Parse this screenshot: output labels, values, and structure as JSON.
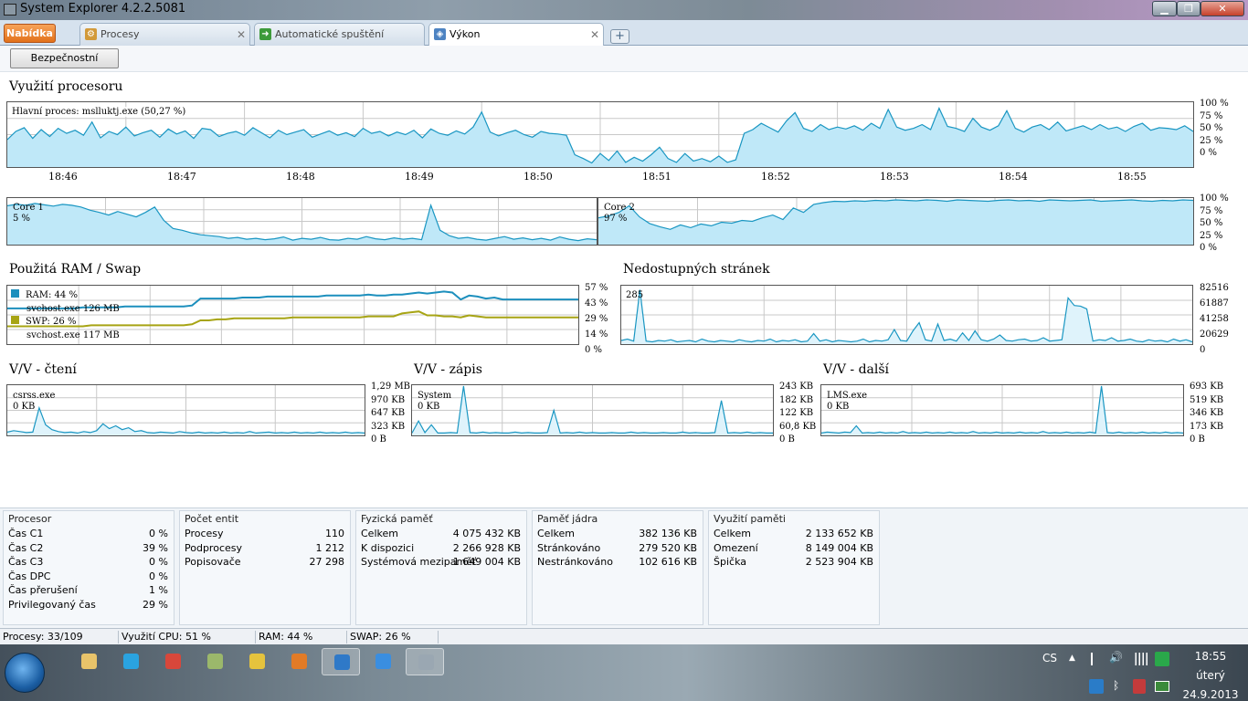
{
  "window": {
    "title": "System Explorer 4.2.2.5081",
    "minimize": "▁",
    "maximize": "❐",
    "close": "✕"
  },
  "menu_button": "Nabídka",
  "tabs": [
    {
      "label": "Procesy",
      "icon": "gear-icon"
    },
    {
      "label": "Automatické spuštění",
      "icon": "startup-arrow-icon"
    },
    {
      "label": "Výkon",
      "icon": "performance-icon"
    }
  ],
  "add_tab": "+",
  "tab_close": "✕",
  "toolbar": {
    "security_button": "Bezpečnostní kontrola"
  },
  "cpu": {
    "title": "Využití procesoru",
    "main_process": "Hlavní proces: mslluktj.exe (50,27 %)",
    "y_axis": [
      "100 %",
      "75 %",
      "50 %",
      "25 %",
      "0 %"
    ],
    "time_ticks": [
      "18:46",
      "18:47",
      "18:48",
      "18:49",
      "18:50",
      "18:51",
      "18:52",
      "18:53",
      "18:54",
      "18:55"
    ],
    "series_percent": [
      42,
      55,
      61,
      44,
      58,
      47,
      60,
      52,
      57,
      49,
      70,
      45,
      55,
      50,
      62,
      48,
      53,
      57,
      46,
      59,
      51,
      56,
      44,
      60,
      58,
      47,
      52,
      55,
      49,
      61,
      53,
      45,
      57,
      50,
      54,
      58,
      46,
      51,
      56,
      49,
      53,
      47,
      60,
      52,
      55,
      48,
      54,
      50,
      57,
      45,
      59,
      52,
      49,
      56,
      51,
      62,
      86,
      54,
      48,
      53,
      57,
      50,
      46,
      55,
      52,
      51,
      49,
      18,
      12,
      5,
      20,
      9,
      24,
      6,
      14,
      8,
      18,
      30,
      12,
      6,
      20,
      8,
      12,
      7,
      16,
      6,
      10,
      52,
      58,
      68,
      61,
      54,
      72,
      85,
      60,
      55,
      66,
      58,
      62,
      59,
      64,
      57,
      68,
      60,
      90,
      62,
      57,
      60,
      66,
      58,
      92,
      63,
      60,
      55,
      76,
      62,
      57,
      64,
      88,
      60,
      54,
      62,
      66,
      58,
      70,
      56,
      60,
      64,
      58,
      66,
      59,
      62,
      55,
      63,
      68,
      57,
      61,
      60,
      58,
      64,
      55
    ],
    "core1": {
      "label": "Core 1",
      "value": "5 %",
      "series_percent": [
        85,
        88,
        86,
        90,
        87,
        84,
        88,
        86,
        82,
        75,
        70,
        64,
        72,
        66,
        60,
        70,
        82,
        52,
        34,
        30,
        24,
        20,
        18,
        16,
        12,
        14,
        10,
        12,
        9,
        11,
        15,
        8,
        12,
        10,
        14,
        9,
        8,
        12,
        10,
        16,
        11,
        9,
        13,
        10,
        12,
        9,
        86,
        30,
        18,
        12,
        14,
        10,
        8,
        12,
        16,
        10,
        13,
        9,
        12,
        8,
        15,
        10,
        7,
        11,
        9
      ]
    },
    "core2": {
      "label": "Core 2",
      "value": "97 %",
      "series_percent": [
        58,
        62,
        70,
        85,
        60,
        45,
        38,
        32,
        42,
        36,
        44,
        40,
        48,
        46,
        52,
        50,
        58,
        64,
        54,
        80,
        70,
        88,
        92,
        95,
        94,
        96,
        95,
        97,
        96,
        98,
        97,
        96,
        98,
        97,
        95,
        98,
        97,
        96,
        95,
        97,
        98,
        96,
        97,
        95,
        98,
        97,
        96,
        97,
        98,
        95,
        96,
        97,
        98,
        96,
        95,
        97,
        96,
        98,
        97
      ]
    }
  },
  "ram": {
    "title": "Použitá RAM / Swap",
    "y_axis": [
      "57 %",
      "43 %",
      "29 %",
      "14 %",
      "0 %"
    ],
    "legend": [
      {
        "label": "RAM: 44 %",
        "process": "svchost.exe 126 MB",
        "color": "#1c8fbd"
      },
      {
        "label": "SWP: 26 %",
        "process": "svchost.exe 117 MB",
        "color": "#a7a414"
      }
    ],
    "ram_series_percent": [
      35,
      35,
      35,
      35,
      35,
      35,
      35,
      35,
      35,
      36,
      36,
      36,
      36,
      36,
      37,
      37,
      37,
      37,
      37,
      37,
      37,
      37,
      38,
      45,
      45,
      45,
      45,
      45,
      46,
      46,
      46,
      47,
      47,
      47,
      47,
      47,
      47,
      47,
      48,
      48,
      48,
      48,
      48,
      49,
      48,
      48,
      49,
      49,
      50,
      51,
      50,
      51,
      52,
      51,
      44,
      48,
      47,
      45,
      46,
      44,
      44,
      44,
      44,
      44,
      44,
      44,
      44,
      44,
      44
    ],
    "swp_series_percent": [
      17,
      17,
      17,
      17,
      17,
      17,
      17,
      17,
      17,
      17,
      18,
      18,
      18,
      18,
      18,
      18,
      18,
      18,
      18,
      18,
      18,
      18,
      19,
      23,
      23,
      24,
      24,
      25,
      25,
      25,
      25,
      25,
      25,
      25,
      26,
      26,
      26,
      26,
      26,
      26,
      26,
      26,
      26,
      27,
      27,
      27,
      27,
      30,
      31,
      32,
      28,
      28,
      27,
      27,
      26,
      28,
      27,
      26,
      26,
      26,
      26,
      26,
      26,
      26,
      26,
      26,
      26,
      26,
      26
    ]
  },
  "pagefaults": {
    "title": "Nedostupných stránek",
    "value": "285",
    "y_axis": [
      "82516",
      "61887",
      "41258",
      "20629",
      "0"
    ],
    "series": [
      4000,
      6000,
      3000,
      78000,
      3000,
      2000,
      4000,
      3000,
      5000,
      2000,
      3000,
      4000,
      2000,
      6000,
      3000,
      2000,
      4000,
      3000,
      2000,
      5000,
      3000,
      2000,
      4000,
      3000,
      6000,
      2000,
      4000,
      3000,
      5000,
      2000,
      3000,
      14000,
      3000,
      5000,
      2000,
      4000,
      3000,
      2000,
      3000,
      6000,
      2000,
      4000,
      3000,
      5000,
      20000,
      4000,
      3000,
      18000,
      30000,
      5000,
      3000,
      28000,
      4000,
      6000,
      3000,
      15000,
      4000,
      18000,
      5000,
      3000,
      6000,
      12000,
      4000,
      3000,
      5000,
      6000,
      3000,
      4000,
      8000,
      3000,
      4000,
      5000,
      66000,
      55000,
      54000,
      50000,
      3000,
      5000,
      4000,
      8000,
      3000,
      4000,
      6000,
      3000,
      2000,
      5000,
      3000,
      4000,
      2000,
      6000,
      3000,
      5000,
      2000
    ]
  },
  "io_read": {
    "title": "V/V - čtení",
    "process": "csrss.exe",
    "value": "0 KB",
    "y_axis": [
      "1,29 MB",
      "970 KB",
      "647 KB",
      "323 KB",
      "0 B"
    ],
    "series_percent": [
      5,
      8,
      6,
      4,
      5,
      55,
      20,
      10,
      6,
      4,
      5,
      3,
      6,
      4,
      8,
      22,
      12,
      18,
      10,
      14,
      6,
      8,
      4,
      3,
      5,
      4,
      3,
      6,
      4,
      3,
      5,
      3,
      4,
      3,
      5,
      3,
      4,
      3,
      6,
      3,
      4,
      5,
      3,
      4,
      3,
      5,
      3,
      4,
      3,
      5,
      3,
      4,
      3,
      5,
      3,
      4,
      3
    ]
  },
  "io_write": {
    "title": "V/V - zápis",
    "process": "System",
    "value": "0 KB",
    "y_axis": [
      "243 KB",
      "182 KB",
      "122 KB",
      "60,8 KB",
      "0 B"
    ],
    "series_percent": [
      3,
      28,
      4,
      20,
      3,
      3,
      4,
      3,
      100,
      4,
      3,
      5,
      3,
      4,
      3,
      3,
      5,
      3,
      4,
      3,
      3,
      4,
      50,
      3,
      4,
      3,
      5,
      3,
      4,
      3,
      3,
      4,
      3,
      3,
      5,
      3,
      4,
      3,
      3,
      4,
      3,
      3,
      5,
      3,
      4,
      3,
      3,
      4,
      70,
      3,
      4,
      3,
      5,
      3,
      4,
      3,
      3
    ]
  },
  "io_other": {
    "title": "V/V - další",
    "process": "LMS.exe",
    "value": "0 KB",
    "y_axis": [
      "693 KB",
      "519 KB",
      "346 KB",
      "173 KB",
      "0 B"
    ],
    "series_percent": [
      3,
      5,
      4,
      3,
      5,
      4,
      18,
      3,
      4,
      3,
      5,
      3,
      4,
      3,
      6,
      3,
      4,
      3,
      5,
      3,
      4,
      3,
      5,
      3,
      4,
      3,
      6,
      3,
      4,
      3,
      5,
      3,
      4,
      3,
      5,
      3,
      4,
      3,
      6,
      3,
      4,
      3,
      5,
      3,
      4,
      3,
      5,
      3,
      100,
      4,
      3,
      5,
      3,
      4,
      3,
      5,
      3,
      4,
      3,
      5,
      3,
      4,
      3
    ]
  },
  "panels": [
    {
      "title": "Procesor",
      "rows": [
        [
          "Čas C1",
          "0 %"
        ],
        [
          "Čas C2",
          "39 %"
        ],
        [
          "Čas C3",
          "0 %"
        ],
        [
          "Čas DPC",
          "0 %"
        ],
        [
          "Čas přerušení",
          "1 %"
        ],
        [
          "Privilegovaný čas",
          "29 %"
        ]
      ]
    },
    {
      "title": "Počet entit",
      "rows": [
        [
          "Procesy",
          "110"
        ],
        [
          "Podprocesy",
          "1 212"
        ],
        [
          "Popisovače",
          "27 298"
        ]
      ]
    },
    {
      "title": "Fyzická paměť",
      "rows": [
        [
          "Celkem",
          "4 075 432 KB"
        ],
        [
          "K dispozici",
          "2 266 928 KB"
        ],
        [
          "Systémová mezipaměť",
          "1 649 004 KB"
        ]
      ]
    },
    {
      "title": "Paměť jádra",
      "rows": [
        [
          "Celkem",
          "382 136 KB"
        ],
        [
          "Stránkováno",
          "279 520 KB"
        ],
        [
          "Nestránkováno",
          "102 616 KB"
        ]
      ]
    },
    {
      "title": "Využití paměti",
      "rows": [
        [
          "Celkem",
          "2 133 652 KB"
        ],
        [
          "Omezení",
          "8 149 004 KB"
        ],
        [
          "Špička",
          "2 523 904 KB"
        ]
      ]
    }
  ],
  "statusbar": [
    "Procesy: 33/109",
    "Využití CPU: 51 %",
    "RAM: 44 %",
    "SWAP: 26 %"
  ],
  "taskbar": {
    "apps": [
      {
        "name": "explorer-icon",
        "color": "#e8c36a"
      },
      {
        "name": "skype-icon",
        "color": "#2aa3e0"
      },
      {
        "name": "phone-icon",
        "color": "#d8473b"
      },
      {
        "name": "notes-icon",
        "color": "#9bb86b"
      },
      {
        "name": "chrome-icon",
        "color": "#e5c33d"
      },
      {
        "name": "firefox-icon",
        "color": "#e27b26"
      },
      {
        "name": "remote-desktop-icon",
        "color": "#2f79c8"
      },
      {
        "name": "ie-icon",
        "color": "#3a8ee0"
      },
      {
        "name": "system-explorer-icon",
        "color": "#9aa7b2"
      }
    ],
    "language": "CS",
    "tray_arrow": "▲",
    "time": "18:55",
    "weekday": "úterý",
    "date": "24.9.2013"
  }
}
